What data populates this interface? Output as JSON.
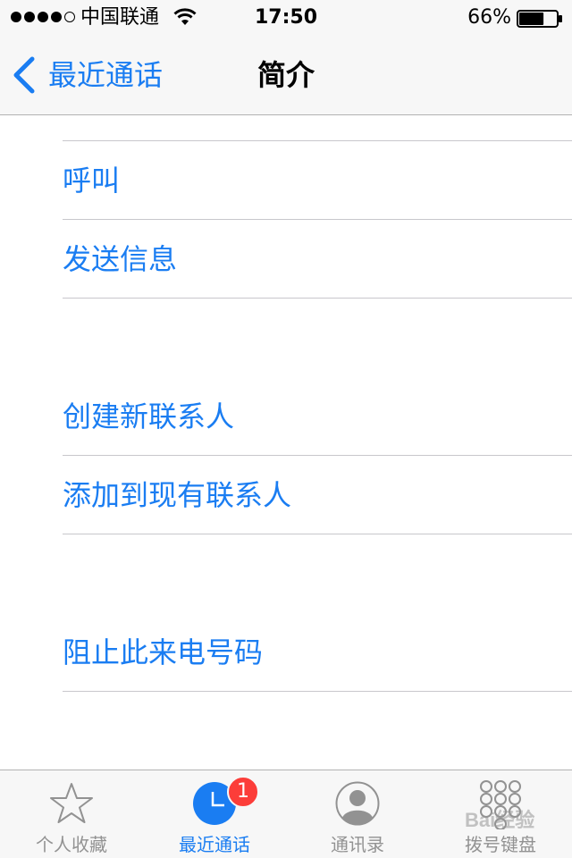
{
  "status_bar": {
    "carrier": "中国联通",
    "time": "17:50",
    "battery": "66%",
    "battery_level": 0.66
  },
  "nav": {
    "back_label": "最近通话",
    "title": "简介"
  },
  "actions": {
    "call": "呼叫",
    "send_message": "发送信息",
    "create_contact": "创建新联系人",
    "add_to_existing": "添加到现有联系人",
    "block_caller": "阻止此来电号码"
  },
  "tabs": [
    {
      "label": "个人收藏",
      "icon": "star-icon",
      "active": false
    },
    {
      "label": "最近通话",
      "icon": "clock-icon",
      "active": true,
      "badge": "1"
    },
    {
      "label": "通讯录",
      "icon": "contacts-icon",
      "active": false
    },
    {
      "label": "拨号键盘",
      "icon": "keypad-icon",
      "active": false
    }
  ],
  "watermark": "Bai经验",
  "colors": {
    "accent": "#1a7df2",
    "badge": "#fc3d39",
    "inactive": "#929292",
    "bar_background": "#f7f7f7"
  }
}
